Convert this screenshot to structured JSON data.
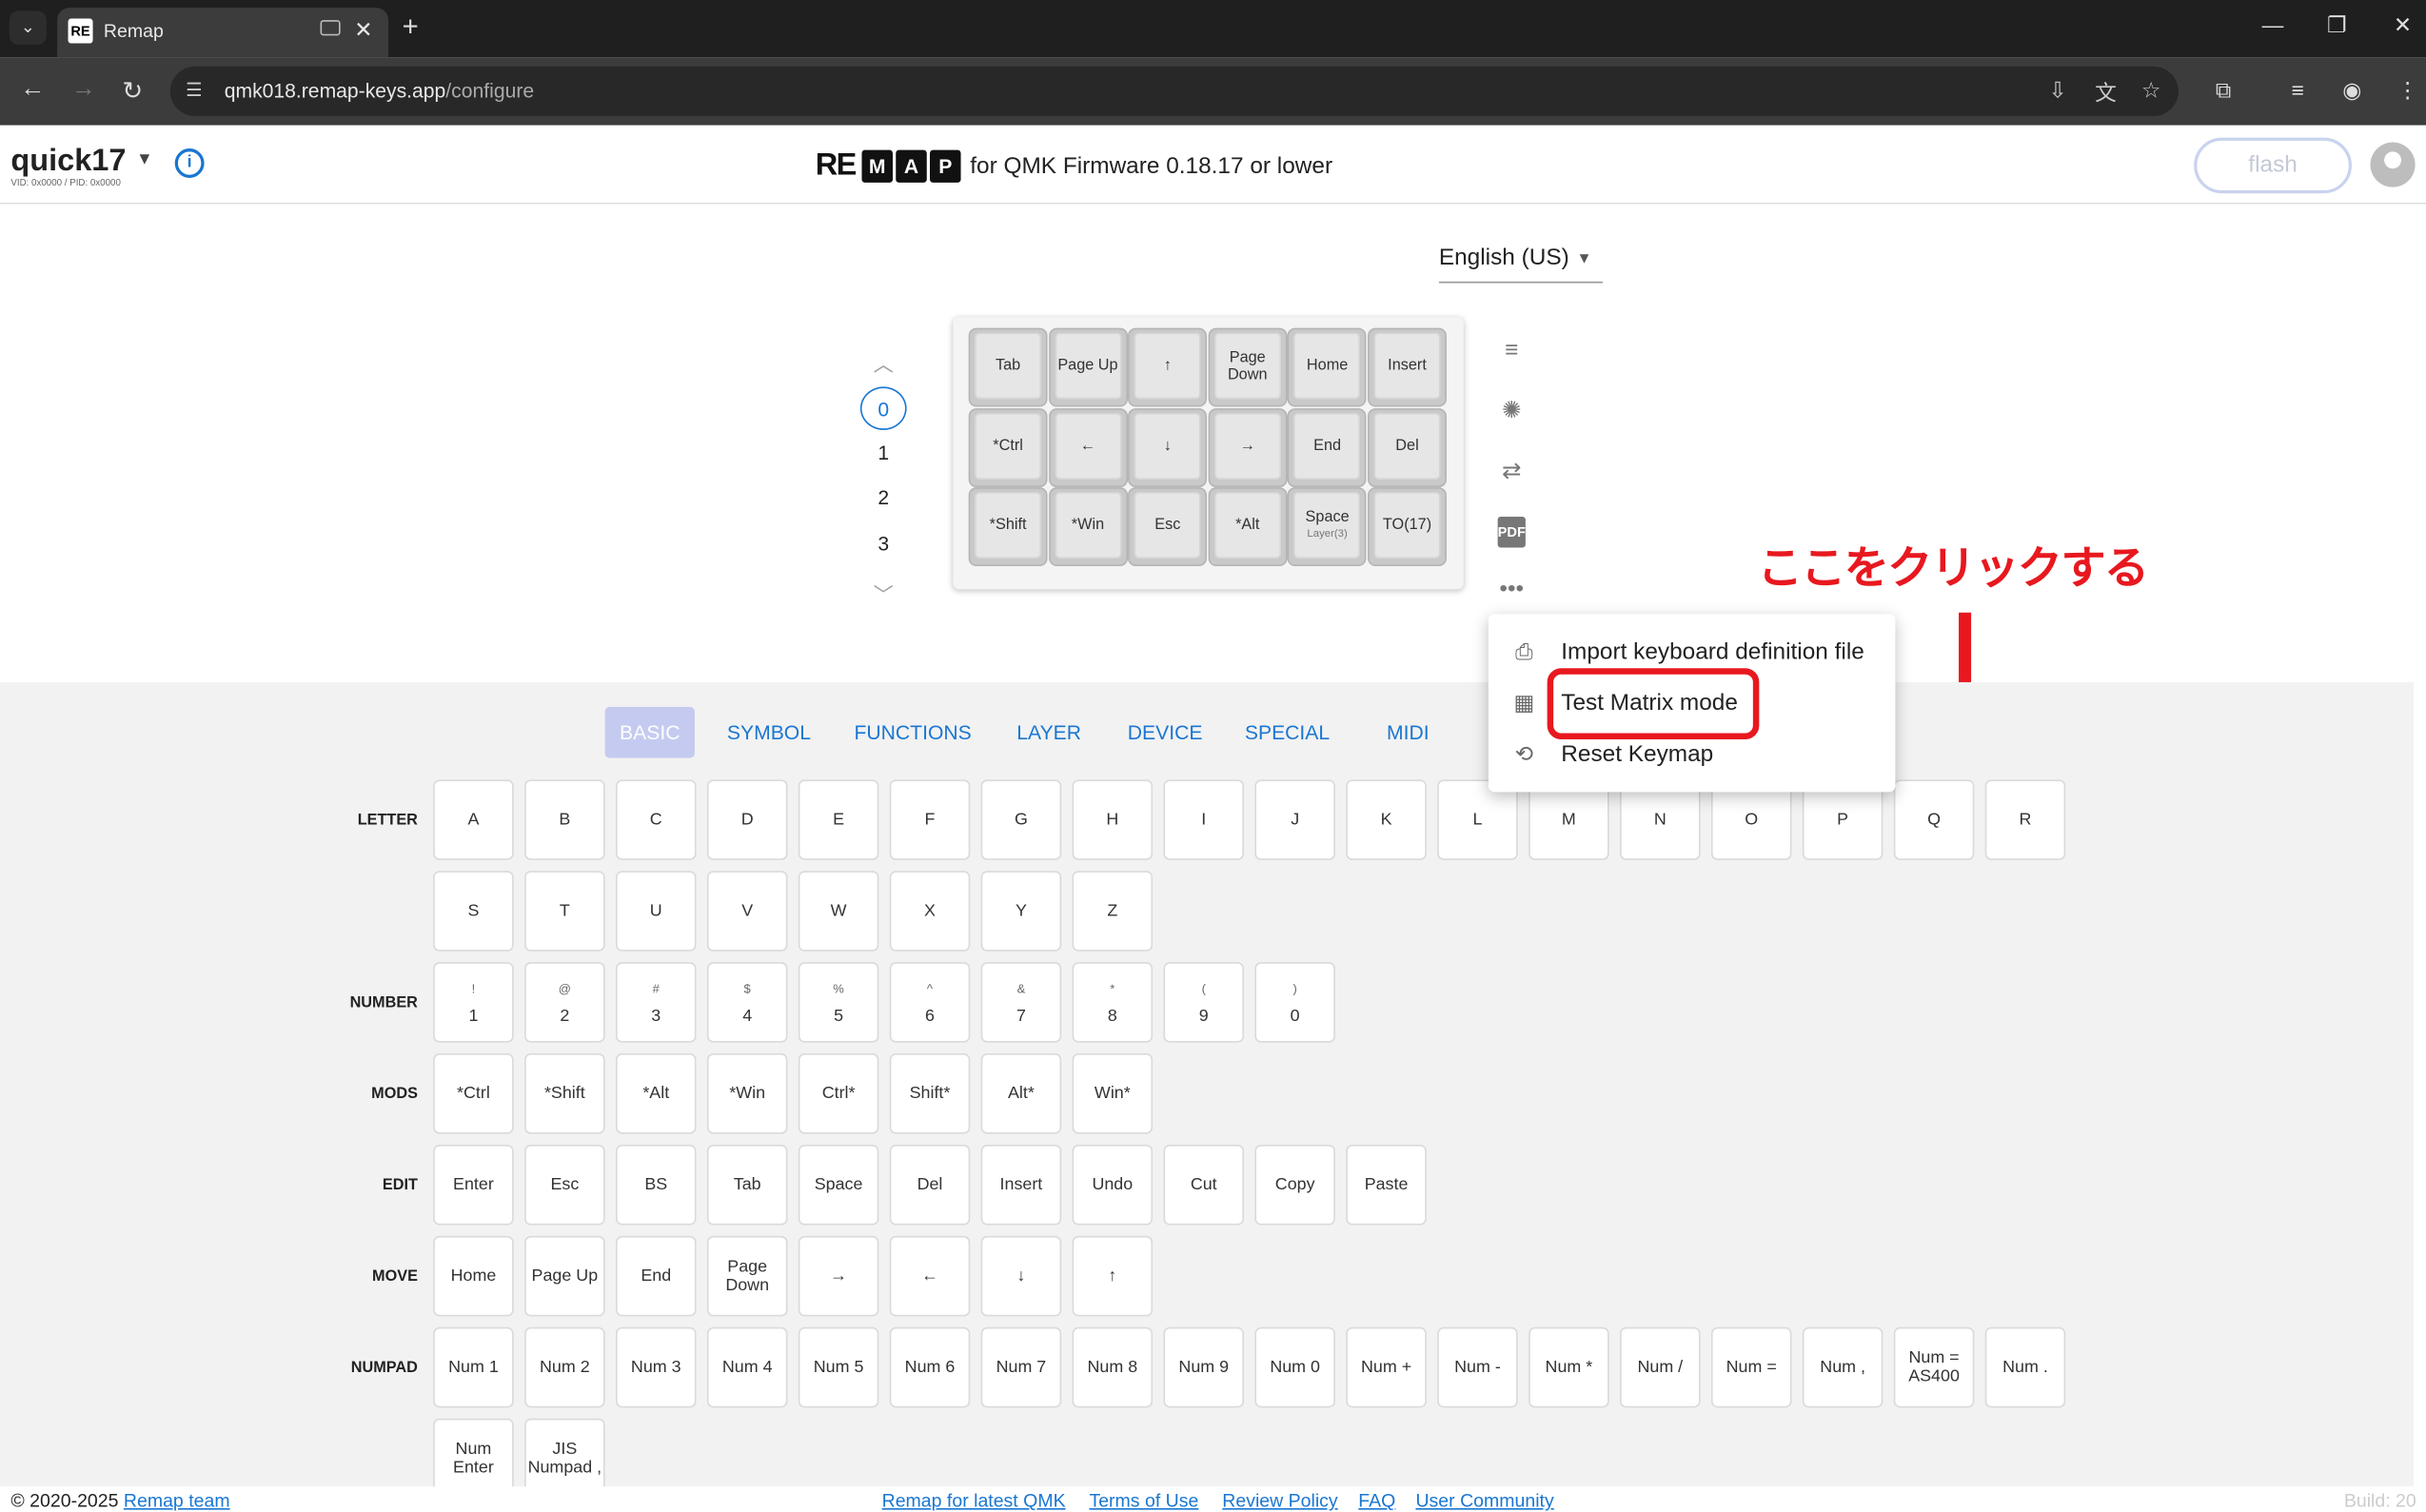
{
  "browser": {
    "tab_title": "Remap",
    "tab_favicon": "RE",
    "url_host": "qmk018.remap-keys.app",
    "url_path": "/configure"
  },
  "header": {
    "keyboard_name": "quick17",
    "vid_pid": "VID: 0x0000 / PID: 0x0000",
    "logo_re": "RE",
    "logo_boxes": [
      "M",
      "A",
      "P"
    ],
    "tagline": "for QMK Firmware 0.18.17 or lower",
    "flash_label": "flash"
  },
  "language": {
    "selected": "English (US)"
  },
  "layers": {
    "items": [
      "0",
      "1",
      "2",
      "3"
    ],
    "active_layer": "0"
  },
  "keyboard": {
    "rows": [
      [
        {
          "label": "Tab"
        },
        {
          "label": "Page Up"
        },
        {
          "label": "↑"
        },
        {
          "label": "Page Down"
        },
        {
          "label": "Home"
        },
        {
          "label": "Insert"
        }
      ],
      [
        {
          "label": "*Ctrl"
        },
        {
          "label": "←"
        },
        {
          "label": "↓"
        },
        {
          "label": "→"
        },
        {
          "label": "End"
        },
        {
          "label": "Del"
        }
      ],
      [
        {
          "label": "*Shift"
        },
        {
          "label": "*Win"
        },
        {
          "label": "Esc"
        },
        {
          "label": "*Alt"
        },
        {
          "label": "Space",
          "sub": "Layer(3)"
        },
        {
          "label": "TO(17)"
        }
      ]
    ]
  },
  "side_tools": [
    "text-lines-icon",
    "lighting-icon",
    "swap-icon",
    "pdf-icon",
    "more-icon"
  ],
  "menu": {
    "items": [
      {
        "label": "Import keyboard definition file",
        "icon": "file-upload-icon"
      },
      {
        "label": "Test Matrix mode",
        "icon": "grid-icon"
      },
      {
        "label": "Reset Keymap",
        "icon": "history-icon"
      }
    ]
  },
  "annotation": {
    "text": "ここをクリックする",
    "color": "#e8181f"
  },
  "palette": {
    "categories": [
      "BASIC",
      "SYMBOL",
      "FUNCTIONS",
      "LAYER",
      "DEVICE",
      "SPECIAL",
      "MIDI"
    ],
    "active_category": "BASIC",
    "groups": [
      {
        "label": "LETTER",
        "keys": [
          [
            "A"
          ],
          [
            "B"
          ],
          [
            "C"
          ],
          [
            "D"
          ],
          [
            "E"
          ],
          [
            "F"
          ],
          [
            "G"
          ],
          [
            "H"
          ],
          [
            "I"
          ],
          [
            "J"
          ],
          [
            "K"
          ],
          [
            "L"
          ],
          [
            "M"
          ],
          [
            "N"
          ],
          [
            "O"
          ],
          [
            "P"
          ],
          [
            "Q"
          ],
          [
            "R"
          ],
          [
            "S"
          ],
          [
            "T"
          ],
          [
            "U"
          ],
          [
            "V"
          ],
          [
            "W"
          ],
          [
            "X"
          ],
          [
            "Y"
          ],
          [
            "Z"
          ]
        ]
      },
      {
        "label": "NUMBER",
        "keys": [
          [
            "1",
            "!"
          ],
          [
            "2",
            "@"
          ],
          [
            "3",
            "#"
          ],
          [
            "4",
            "$"
          ],
          [
            "5",
            "%"
          ],
          [
            "6",
            "^"
          ],
          [
            "7",
            "&"
          ],
          [
            "8",
            "*"
          ],
          [
            "9",
            "("
          ],
          [
            "0",
            ")"
          ]
        ]
      },
      {
        "label": "MODS",
        "keys": [
          [
            "*Ctrl"
          ],
          [
            "*Shift"
          ],
          [
            "*Alt"
          ],
          [
            "*Win"
          ],
          [
            "Ctrl*"
          ],
          [
            "Shift*"
          ],
          [
            "Alt*"
          ],
          [
            "Win*"
          ]
        ]
      },
      {
        "label": "EDIT",
        "keys": [
          [
            "Enter"
          ],
          [
            "Esc"
          ],
          [
            "BS"
          ],
          [
            "Tab"
          ],
          [
            "Space"
          ],
          [
            "Del"
          ],
          [
            "Insert"
          ],
          [
            "Undo"
          ],
          [
            "Cut"
          ],
          [
            "Copy"
          ],
          [
            "Paste"
          ]
        ]
      },
      {
        "label": "MOVE",
        "keys": [
          [
            "Home"
          ],
          [
            "Page Up"
          ],
          [
            "End"
          ],
          [
            "Page Down"
          ],
          [
            "→"
          ],
          [
            "←"
          ],
          [
            "↓"
          ],
          [
            "↑"
          ]
        ]
      },
      {
        "label": "NUMPAD",
        "keys": [
          [
            "Num 1"
          ],
          [
            "Num 2"
          ],
          [
            "Num 3"
          ],
          [
            "Num 4"
          ],
          [
            "Num 5"
          ],
          [
            "Num 6"
          ],
          [
            "Num 7"
          ],
          [
            "Num 8"
          ],
          [
            "Num 9"
          ],
          [
            "Num 0"
          ],
          [
            "Num +"
          ],
          [
            "Num -"
          ],
          [
            "Num *"
          ],
          [
            "Num /"
          ],
          [
            "Num ="
          ],
          [
            "Num ,"
          ],
          [
            "Num = AS400"
          ],
          [
            "Num ."
          ],
          [
            "Num Enter"
          ],
          [
            "JIS Numpad ,"
          ]
        ]
      }
    ]
  },
  "footer": {
    "copyright": "© 2020-2025",
    "team_link": "Remap team",
    "links": [
      "Remap for latest QMK",
      "Terms of Use",
      "Review Policy",
      "FAQ",
      "User Community"
    ],
    "build": "Build: 20"
  }
}
